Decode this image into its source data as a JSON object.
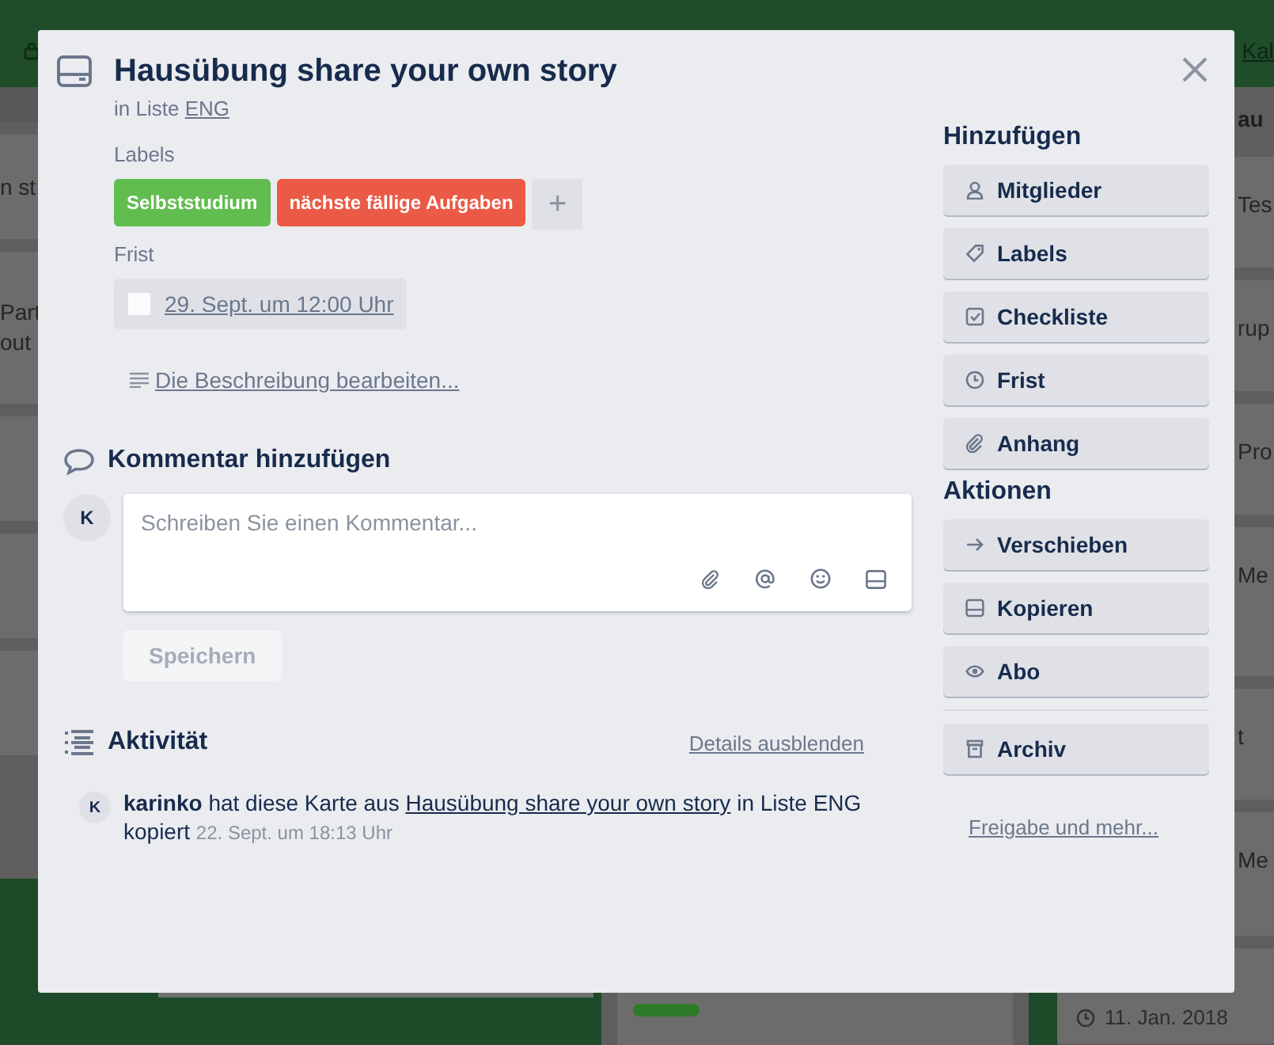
{
  "board": {
    "header_link": "Kal",
    "left_list": {
      "cards": [
        {
          "lines": [
            "n st"
          ]
        },
        {
          "lines": [
            "Part",
            "out"
          ]
        }
      ]
    },
    "right_list": {
      "title": "au",
      "cards": [
        {
          "lines": [
            "Tes"
          ]
        },
        {
          "lines": [
            "rup"
          ]
        },
        {
          "lines": [
            "Pro"
          ]
        },
        {
          "lines": [
            "Me"
          ]
        },
        {
          "lines": [
            "t"
          ]
        },
        {
          "lines": [
            "Me"
          ]
        }
      ],
      "last_card": {
        "date": "11. Jan. 2018"
      }
    }
  },
  "card": {
    "title": "Hausübung share your own story",
    "list_prefix": "in Liste",
    "list_name": "ENG",
    "labels_heading": "Labels",
    "labels": [
      {
        "text": "Selbststudium",
        "color": "#61bd4f"
      },
      {
        "text": "nächste fällige Aufgaben",
        "color": "#eb5a46"
      }
    ],
    "add_label": "+",
    "due_heading": "Frist",
    "due": {
      "text": "29. Sept. um 12:00 Uhr",
      "checked": false
    },
    "description_link": "Die Beschreibung bearbeiten...",
    "comment_heading": "Kommentar hinzufügen",
    "comment": {
      "avatar": "K",
      "placeholder": "Schreiben Sie einen Kommentar...",
      "save": "Speichern",
      "save_disabled": true
    },
    "activity_heading": "Aktivität",
    "details_link": "Details ausblenden",
    "activity": [
      {
        "avatar": "K",
        "before": "**karinko** hat diese Karte aus",
        "link": "Hausübung share your own story",
        "after": "in Liste ENG kopiert",
        "date": "22. Sept. um 18:13 Uhr"
      }
    ]
  },
  "sidebar": {
    "add_heading": "Hinzufügen",
    "add_buttons": [
      {
        "label": "Mitglieder",
        "kind": "person"
      },
      {
        "label": "Labels",
        "kind": "tag"
      },
      {
        "label": "Checkliste",
        "kind": "checklist"
      },
      {
        "label": "Frist",
        "kind": "clock"
      },
      {
        "label": "Anhang",
        "kind": "clip"
      }
    ],
    "actions_heading": "Aktionen",
    "action_buttons": [
      {
        "label": "Verschieben",
        "kind": "arrow"
      },
      {
        "label": "Kopieren",
        "kind": "card"
      },
      {
        "label": "Abo",
        "kind": "eye"
      },
      {
        "label": "Archiv",
        "kind": "archive",
        "separated": true
      }
    ],
    "share_link": "Freigabe und mehr..."
  }
}
